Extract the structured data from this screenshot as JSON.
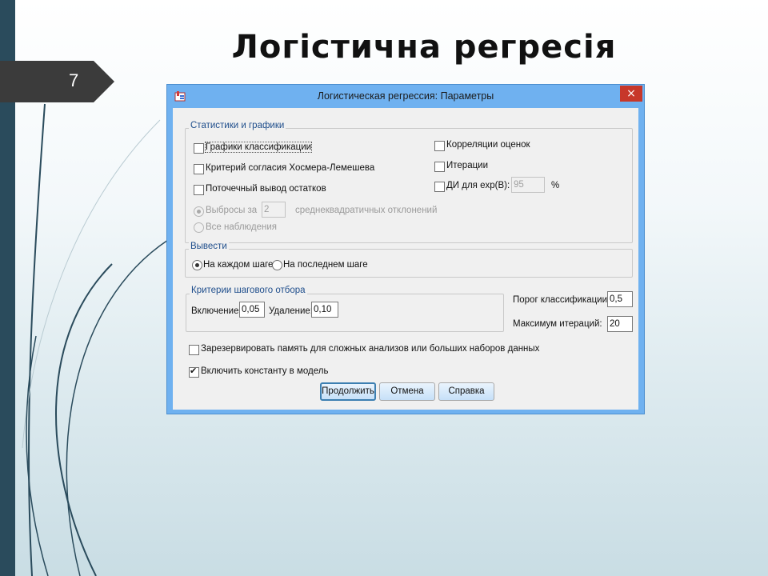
{
  "slide": {
    "number": "7",
    "title": "Логістична регресія"
  },
  "dialog": {
    "title": "Логистическая регрессия: Параметры",
    "close": "×",
    "stats_group": {
      "legend": "Статистики и графики",
      "classification_plots": "Графики классификации",
      "hosmer_lemeshow": "Критерий согласия Хосмера-Лемешева",
      "casewise_residuals": "Поточечный вывод остатков",
      "outliers_label": "Выбросы за",
      "outliers_value": "2",
      "outliers_unit": "среднеквадратичных отклонений",
      "all_cases": "Все наблюдения",
      "correlations": "Корреляции оценок",
      "iterations": "Итерации",
      "ci_label": "ДИ для exp(B):",
      "ci_value": "95",
      "ci_unit": "%"
    },
    "display_group": {
      "legend": "Вывести",
      "each_step": "На каждом шаге",
      "last_step": "На последнем шаге"
    },
    "stepwise_group": {
      "legend": "Критерии шагового отбора",
      "entry_label": "Включение:",
      "entry_value": "0,05",
      "removal_label": "Удаление:",
      "removal_value": "0,10"
    },
    "classification_cutoff_label": "Порог классификации:",
    "classification_cutoff_value": "0,5",
    "max_iterations_label": "Максимум итераций:",
    "max_iterations_value": "20",
    "reserve_memory": "Зарезервировать память для сложных анализов или больших наборов данных",
    "include_constant": "Включить константу в модель",
    "buttons": {
      "continue": "Продолжить",
      "cancel": "Отмена",
      "help": "Справка"
    }
  },
  "colors": {
    "titlebar": "#6fb1f0",
    "close": "#c7372a",
    "left_bar": "#2a4b5c",
    "slide_tab": "#3b3b3b"
  }
}
